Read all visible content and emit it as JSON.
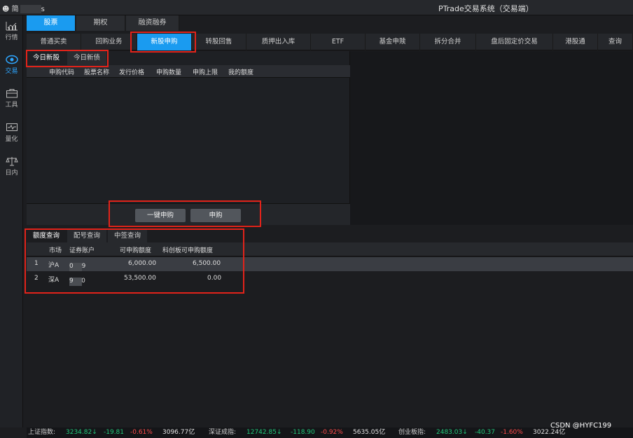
{
  "titlebar": {
    "user_label": "简",
    "user_suffix": "s",
    "app_title": "PTrade交易系统（交易端）"
  },
  "nav": [
    {
      "label": "行情",
      "icon": "chart-icon"
    },
    {
      "label": "交易",
      "icon": "eye-icon"
    },
    {
      "label": "工具",
      "icon": "briefcase-icon"
    },
    {
      "label": "量化",
      "icon": "monitor-icon"
    },
    {
      "label": "日内",
      "icon": "scale-icon"
    }
  ],
  "account_tabs": [
    "股票",
    "期权",
    "融资融券"
  ],
  "func_tabs": [
    "普通买卖",
    "回购业务",
    "新股申购",
    "转股回售",
    "质押出入库",
    "ETF",
    "基金申赎",
    "拆分合并",
    "盘后固定价交易",
    "港股通",
    "查询"
  ],
  "ipo": {
    "subtabs": [
      "今日新股",
      "今日新债"
    ],
    "columns": [
      "申购代码",
      "股票名称",
      "发行价格",
      "申购数量",
      "申购上限",
      "我的额度"
    ],
    "buttons": {
      "one_click": "一键申购",
      "subscribe": "申购"
    }
  },
  "quota": {
    "tabs": [
      "额度查询",
      "配号查询",
      "中签查询"
    ],
    "columns": [
      "市场",
      "证券账户",
      "可申购额度",
      "科创板可申购额度"
    ],
    "rows": [
      {
        "idx": "1",
        "market": "沪A",
        "acct_pre": "A419",
        "acct_post": "0",
        "quota": "6,000.00",
        "star_quota": "6,500.00"
      },
      {
        "idx": "2",
        "market": "深A",
        "acct_pre": "0000",
        "acct_post": "9",
        "quota": "53,500.00",
        "star_quota": "0.00"
      }
    ]
  },
  "status": {
    "sh_label": "上证指数:",
    "sh_val": "3234.82↓",
    "sh_chg": "-19.81",
    "sh_pct": "-0.61%",
    "sh_amt": "3096.77亿",
    "sz_label": "深证成指:",
    "sz_val": "12742.85↓",
    "sz_chg": "-118.90",
    "sz_pct": "-0.92%",
    "sz_amt": "5635.05亿",
    "cy_label": "创业板指:",
    "cy_val": "2483.03↓",
    "cy_chg": "-40.37",
    "cy_pct": "-1.60%",
    "cy_amt": "3022.24亿"
  },
  "watermark": "CSDN @HYFC199",
  "colors": {
    "accent": "#1a9bf0",
    "highlight_box": "#e2231a",
    "up_down_green": "#21c87a",
    "down_red": "#ff4b4b"
  }
}
